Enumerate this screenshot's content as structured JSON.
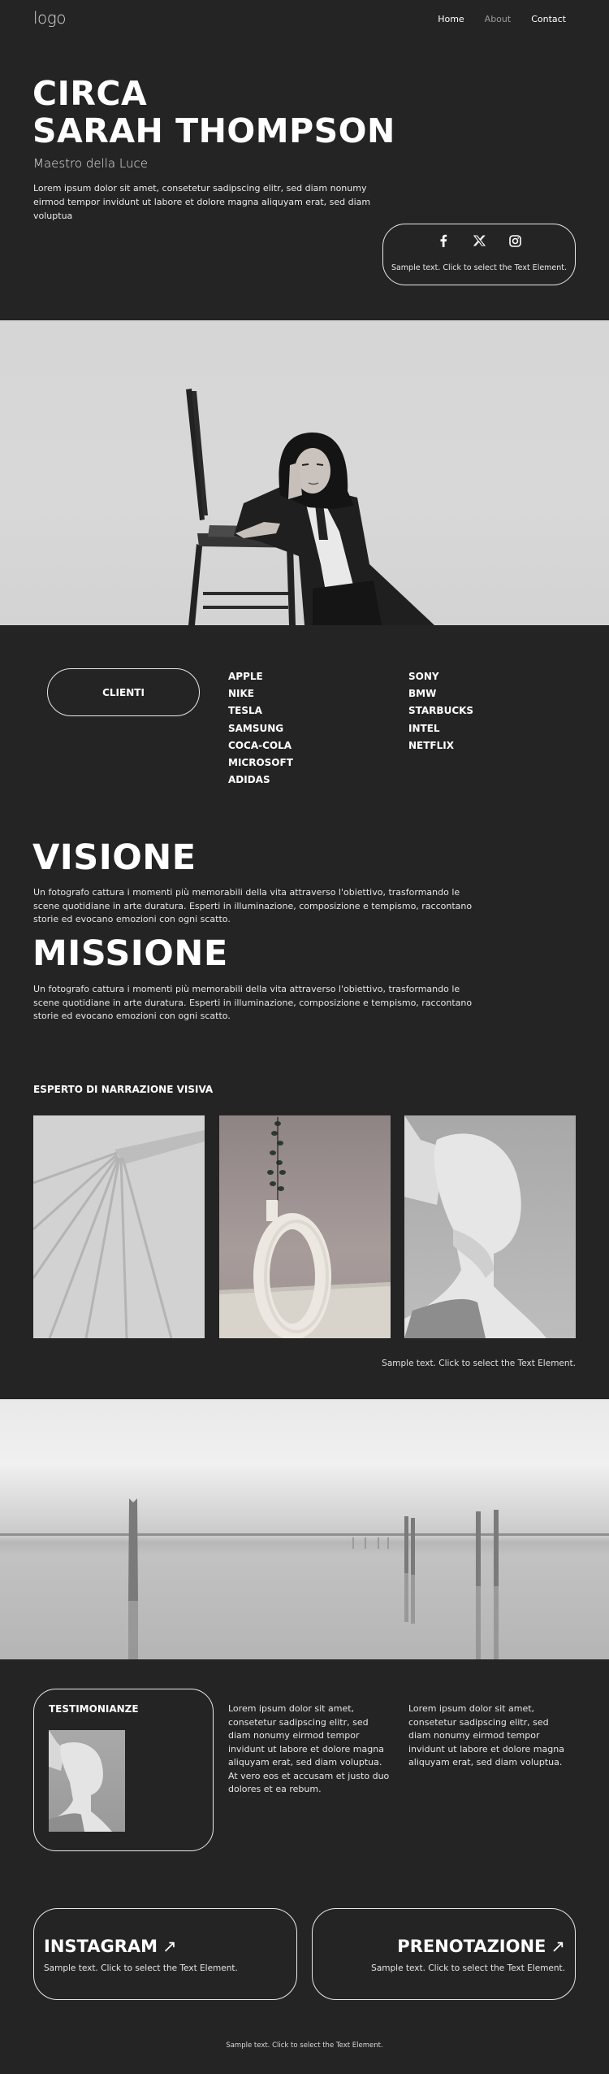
{
  "header": {
    "logo": "logo",
    "nav": [
      {
        "label": "Home",
        "active": false
      },
      {
        "label": "About",
        "active": true
      },
      {
        "label": "Contact",
        "active": false
      }
    ]
  },
  "hero": {
    "title_line1": "CIRCA",
    "title_line2": "SARAH THOMPSON",
    "subtitle": "Maestro della Luce",
    "body": "Lorem ipsum dolor sit amet, consetetur sadipscing elitr, sed diam nonumy eirmod tempor invidunt ut labore et dolore magna aliquyam erat, sed diam voluptua",
    "social": {
      "icons": [
        "facebook-icon",
        "x-icon",
        "instagram-icon"
      ],
      "text": "Sample text. Click to select the Text Element."
    }
  },
  "clients": {
    "button_label": "CLIENTI",
    "column1": [
      "APPLE",
      "NIKE",
      "TESLA",
      "SAMSUNG",
      "COCA-COLA",
      "MICROSOFT",
      "ADIDAS"
    ],
    "column2": [
      "SONY",
      "BMW",
      "STARBUCKS",
      "INTEL",
      "NETFLIX"
    ]
  },
  "vision": {
    "title": "VISIONE",
    "body": "Un fotografo cattura i momenti più memorabili della vita attraverso l'obiettivo, trasformando le scene quotidiane in arte duratura. Esperti in illuminazione, composizione e tempismo, raccontano storie ed evocano emozioni con ogni scatto."
  },
  "mission": {
    "title": "MISSIONE",
    "body": "Un fotografo cattura i momenti più memorabili della vita attraverso l'obiettivo, trasformando le scene quotidiane in arte duratura. Esperti in illuminazione, composizione e tempismo, raccontano storie ed evocano emozioni con ogni scatto."
  },
  "gallery": {
    "title": "ESPERTO DI NARRAZIONE VISIVA",
    "caption": "Sample text. Click to select the Text Element."
  },
  "testimonials": {
    "title": "TESTIMONIANZE",
    "text1": "Lorem ipsum dolor sit amet, consetetur sadipscing elitr, sed diam nonumy eirmod tempor invidunt ut labore et dolore magna aliquyam erat, sed diam voluptua. At vero eos et accusam et justo duo dolores et ea rebum.",
    "text2": "Lorem ipsum dolor sit amet, consetetur sadipscing elitr, sed diam nonumy eirmod tempor invidunt ut labore et dolore magna aliquyam erat, sed diam voluptua."
  },
  "cta": {
    "instagram": {
      "title": "INSTAGRAM",
      "arrow": "↗",
      "text": "Sample text. Click to select the Text Element."
    },
    "booking": {
      "title": "PRENOTAZIONE",
      "arrow": "↗",
      "text": "Sample text. Click to select the Text Element."
    }
  },
  "footer": {
    "text": "Sample text. Click to select the Text Element."
  }
}
